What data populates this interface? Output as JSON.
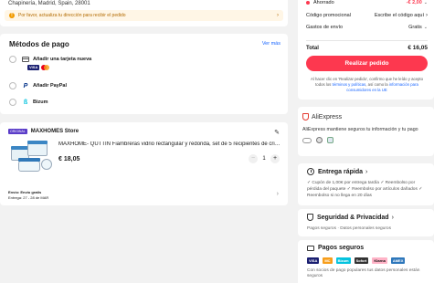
{
  "address": {
    "line": "Chapinería, Madrid, Spain, 28001",
    "warning": "Por favor, actualiza tu dirección para recibir el pedido"
  },
  "payment": {
    "title": "Métodos de pago",
    "more": "Ver más",
    "options": [
      {
        "label": "Añadir una tarjeta nueva"
      },
      {
        "label": "Añadir PayPal"
      },
      {
        "label": "Bizum"
      }
    ],
    "card_brands": [
      "VISA",
      "MC"
    ]
  },
  "store": {
    "tag": "ORIGINAL",
    "name": "MAXHOMES Store",
    "product_title": "MAXHOME- QUTTIN Fiambreras vidrio rectangular y redonda, set de 5 recipientes de cristal ...",
    "price": "€ 18,05",
    "quantity": "1",
    "minus": "−",
    "plus": "+",
    "shipping_line1": "Envío: Envío gratis",
    "shipping_line2": "Entrega: 27 - 28 de MAR"
  },
  "summary": {
    "saved_label": "Ahorrado",
    "saved_value": "-€ 2,00",
    "promo_label": "Código promocional",
    "promo_value": "Escribe el código aquí",
    "shipping_label": "Gastos de envío",
    "shipping_value": "Gratis",
    "total_label": "Total",
    "total_value": "€ 16,05",
    "order_button": "Realizar pedido",
    "legal_part1": "Al hacer clic en 'Realizar pedido', confirmo que he leído y acepto todos los",
    "legal_link1": "términos y políticas",
    "legal_part2": ", así como la",
    "legal_link2": "información para consumidores en la UE"
  },
  "trust": {
    "brand": "AliExpress",
    "tagline": "AliExpress mantiene seguros tu información y tu pago",
    "badges": [
      "pci",
      "ssl",
      "verified"
    ]
  },
  "delivery": {
    "title": "Entrega rápida",
    "item1": "✓ Cupón de 1,00€ por entrega tardía",
    "item2": "✓ Reembolso por pérdida del paquete",
    "item3": "✓ Reembolso por artículos dañados",
    "item4": "✓ Reembolso si no llega en 20 días"
  },
  "privacy": {
    "title": "Seguridad & Privacidad",
    "sub": "Pagos seguros · Datos personales seguros"
  },
  "secure_pay": {
    "title": "Pagos seguros",
    "logos": [
      "VISA",
      "MC",
      "Bizum",
      "Sofort",
      "Klarna",
      "AMEX"
    ],
    "footer": "Con socios de pago populares tus datos personales están seguros"
  },
  "colors": {
    "accent": "#fd384f",
    "warning_bg": "#fff6e6",
    "warning_text": "#b36b00",
    "link": "#1a66ff",
    "store_tag": "#5a3cc8"
  }
}
